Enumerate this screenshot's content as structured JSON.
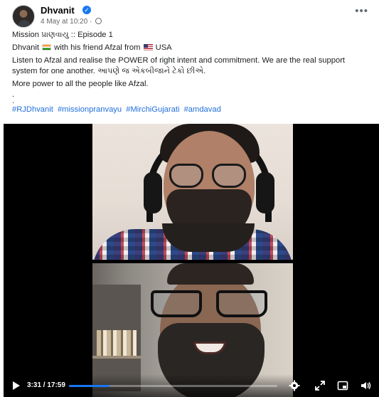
{
  "post": {
    "author": "Dhvanit",
    "timestamp": "4 May at 10:20",
    "more_label": "•••",
    "line1": "Mission પ્રાણવાયુ :: Episode 1",
    "line2_prefix": "Dhvanit",
    "line2_middle": "with his friend Afzal from",
    "line2_suffix": "USA",
    "line3": "Listen to Afzal and realise the POWER of right intent and commitment. We are the real support system for one another. આપણે જ એકબીજાને ટેકો છીએ.",
    "line4": "More power to all the people like Afzal.",
    "dot1": ".",
    "dot2": ".",
    "hashtags": [
      "#RJDhvanit",
      "#missionpranvayu",
      "#MirchiGujarati",
      "#amdavad"
    ]
  },
  "video": {
    "time": "3:31 / 17:59",
    "progress": 0.196,
    "controls": [
      "play-icon",
      "settings-gear-icon",
      "fullscreen-expand-icon",
      "picture-in-picture-icon",
      "volume-icon"
    ]
  },
  "colors": {
    "link": "#216fdb",
    "progress": "#1877f2",
    "verified": "#1877f2"
  }
}
